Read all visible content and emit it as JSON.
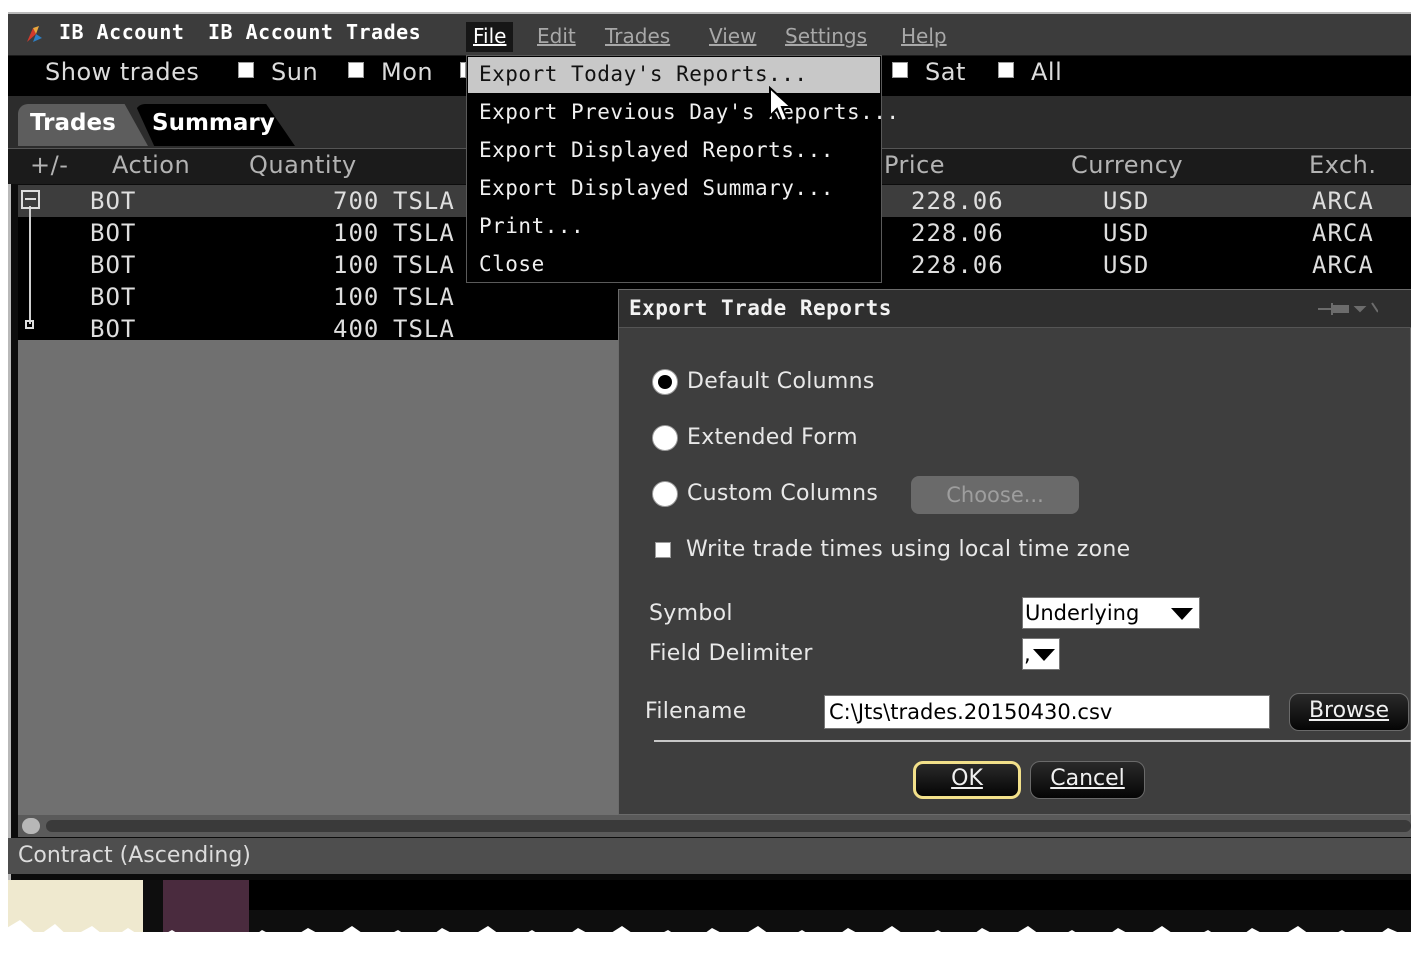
{
  "titlebar": {
    "account": "IB Account",
    "window_title": "IB Account Trades",
    "menus": [
      "File",
      "Edit",
      "Trades",
      "View",
      "Settings",
      "Help"
    ]
  },
  "show_trades": {
    "label": "Show trades",
    "days": [
      "Sun",
      "Mon",
      "Sat",
      "All"
    ]
  },
  "tabs": [
    "Trades",
    "Summary"
  ],
  "columns": {
    "toggle": "+/-",
    "action": "Action",
    "quantity": "Quantity",
    "price": "Price",
    "currency": "Currency",
    "exchange": "Exch."
  },
  "rows": [
    {
      "action": "BOT",
      "qty": "700",
      "sym": "TSLA",
      "price": "228.06",
      "ccy": "USD",
      "exch": "ARCA"
    },
    {
      "action": "BOT",
      "qty": "100",
      "sym": "TSLA",
      "price": "228.06",
      "ccy": "USD",
      "exch": "ARCA"
    },
    {
      "action": "BOT",
      "qty": "100",
      "sym": "TSLA",
      "price": "228.06",
      "ccy": "USD",
      "exch": "ARCA"
    },
    {
      "action": "BOT",
      "qty": "100",
      "sym": "TSLA",
      "price": "",
      "ccy": "",
      "exch": ""
    },
    {
      "action": "BOT",
      "qty": "400",
      "sym": "TSLA",
      "price": "",
      "ccy": "",
      "exch": ""
    }
  ],
  "file_menu": {
    "items": [
      "Export Today's Reports...",
      "Export Previous Day's Reports...",
      "Export Displayed Reports...",
      "Export Displayed Summary...",
      "Print...",
      "Close"
    ],
    "selected_index": 0
  },
  "status_bar": "Contract (Ascending)",
  "dialog": {
    "title": "Export Trade Reports",
    "radio_default": "Default Columns",
    "radio_extended": "Extended Form",
    "radio_custom": "Custom Columns",
    "choose_button": "Choose...",
    "local_time_label": "Write trade times using local time zone",
    "symbol_label": "Symbol",
    "symbol_value": "Underlying",
    "delimiter_label": "Field Delimiter",
    "delimiter_value": ",",
    "filename_label": "Filename",
    "filename_value": "C:\\Jts\\trades.20150430.csv",
    "browse_button": "Browse",
    "ok_button": "OK",
    "cancel_button": "Cancel"
  },
  "colors": {
    "window_bg": "#0c0c0c",
    "grid_bg": "#707070",
    "dialog_bg": "#3e3e3e",
    "ok_border": "#f2e08a",
    "menu_highlight": "#c8c8c8"
  }
}
